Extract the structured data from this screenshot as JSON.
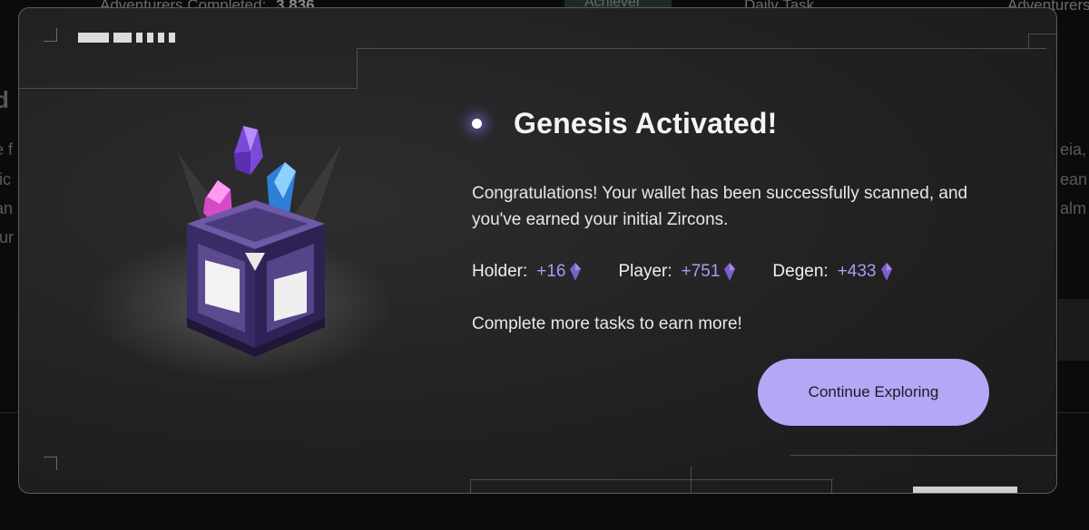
{
  "background": {
    "adventurers_completed_label": "Adventurers Completed:",
    "adventurers_completed_value": "3,836",
    "achiever_tab": "Achiever",
    "daily_task_tab": "Daily Task",
    "adventurers_right": "Adventurers C",
    "left_fragments": [
      "d",
      "e f",
      "tic",
      "an",
      "tur"
    ],
    "right_fragments": [
      "eia,",
      "ean",
      "alm"
    ]
  },
  "modal": {
    "title": "Genesis Activated!",
    "message": "Congratulations! Your wallet has been successfully scanned, and you've earned your initial Zircons.",
    "rewards": [
      {
        "label": "Holder:",
        "value": "+16",
        "icon": "zircon-gem-icon"
      },
      {
        "label": "Player:",
        "value": "+751",
        "icon": "zircon-gem-icon"
      },
      {
        "label": "Degen:",
        "value": "+433",
        "icon": "zircon-gem-icon"
      }
    ],
    "hint": "Complete more tasks to earn more!",
    "cta_label": "Continue Exploring",
    "hero_image": "genesis-crystal-chest",
    "accent_color": "#b3a7f6",
    "reward_value_color": "#a79cf0"
  }
}
